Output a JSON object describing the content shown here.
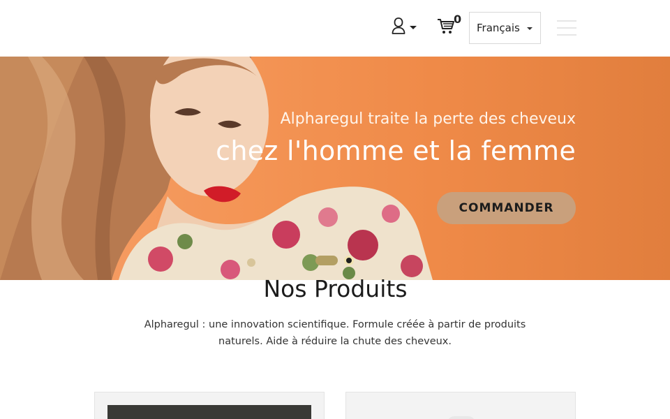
{
  "header": {
    "user_icon": "user-icon",
    "cart_icon": "cart-icon",
    "cart_count": "0",
    "language": "Français",
    "menu_icon": "hamburger-menu-icon"
  },
  "hero": {
    "line1": "Alpharegul traite la perte des cheveux",
    "line2": "chez l'homme et la femme",
    "cta_label": "COMMANDER",
    "slides": 2,
    "active_slide": 1
  },
  "products": {
    "title": "Nos Produits",
    "description": "Alpharegul : une innovation scientifique. Formule créée à partir de produits naturels. Aide à réduire la chute des cheveux."
  },
  "colors": {
    "accent": "#c9a07c",
    "hero_bg": "#f49556",
    "underline": "#d7b794"
  }
}
